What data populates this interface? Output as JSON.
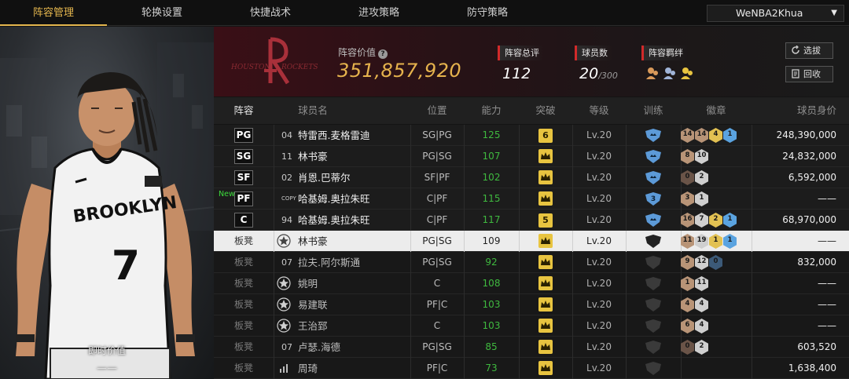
{
  "nav": {
    "tabs": [
      "阵容管理",
      "轮换设置",
      "快捷战术",
      "进攻策略",
      "防守策略"
    ],
    "active_tab": 0,
    "user": "WeNBA2Khua"
  },
  "player_card": {
    "jersey_text": "BROOKLYN",
    "jersey_number": "7",
    "instant_value_label": "即时价值",
    "instant_value": "——"
  },
  "team": {
    "logo_text_1": "HOUSTON",
    "logo_text_2": "ROCKETS",
    "value_label": "阵容价值",
    "value": "351,857,920",
    "overall_label": "阵容总评",
    "overall": "112",
    "players_label": "球员数",
    "players": "20",
    "players_max": "/300",
    "bond_label": "阵容羁绊",
    "btn_select": "选拔",
    "btn_recycle": "回收"
  },
  "table": {
    "headers": [
      "阵容",
      "球员名",
      "位置",
      "能力",
      "突破",
      "等级",
      "训练",
      "徽章",
      "球员身价"
    ],
    "rows": [
      {
        "slot": "PG",
        "bench": false,
        "new": false,
        "jersey": "04",
        "name": "特雷西.麦格雷迪",
        "pos": "SG|PG",
        "ability": "125",
        "breakthrough": "6",
        "level": "Lv.20",
        "training": "",
        "badges": [
          "14",
          "14",
          "4",
          "1"
        ],
        "badge_colors": [
          "#b89477",
          "#b89477",
          "#e2c152",
          "#5aa3e0"
        ],
        "salary": "248,390,000"
      },
      {
        "slot": "SG",
        "bench": false,
        "new": false,
        "jersey": "11",
        "name": "林书豪",
        "pos": "PG|SG",
        "ability": "107",
        "breakthrough": "",
        "level": "Lv.20",
        "training": "",
        "badges": [
          "8",
          "10"
        ],
        "badge_colors": [
          "#b89477",
          "#cfcfcf"
        ],
        "salary": "24,832,000"
      },
      {
        "slot": "SF",
        "bench": false,
        "new": false,
        "jersey": "02",
        "name": "肖恩.巴蒂尔",
        "pos": "SF|PF",
        "ability": "102",
        "breakthrough": "",
        "level": "Lv.20",
        "training": "",
        "badges": [
          "0",
          "2"
        ],
        "badge_colors": [
          "#6a5448",
          "#cfcfcf"
        ],
        "salary": "6,592,000"
      },
      {
        "slot": "PF",
        "bench": false,
        "new": true,
        "new_label": "New",
        "jersey": "COPY",
        "name": "哈基姆.奥拉朱旺",
        "pos": "C|PF",
        "ability": "115",
        "breakthrough": "",
        "level": "Lv.20",
        "training": "3",
        "badges": [
          "3",
          "1"
        ],
        "badge_colors": [
          "#b89477",
          "#cfcfcf"
        ],
        "salary": "——"
      },
      {
        "slot": "C",
        "bench": false,
        "new": false,
        "jersey": "94",
        "name": "哈基姆.奥拉朱旺",
        "pos": "C|PF",
        "ability": "117",
        "breakthrough": "5",
        "level": "Lv.20",
        "training": "",
        "badges": [
          "16",
          "7",
          "2",
          "1"
        ],
        "badge_colors": [
          "#b89477",
          "#cfcfcf",
          "#e2c152",
          "#5aa3e0"
        ],
        "salary": "68,970,000"
      },
      {
        "slot": "板凳",
        "bench": true,
        "highlight": true,
        "new": false,
        "jersey": "",
        "name": "林书豪",
        "pos": "PG|SG",
        "ability": "109",
        "breakthrough": "",
        "level": "Lv.20",
        "training": "",
        "badges": [
          "11",
          "19",
          "1",
          "1"
        ],
        "badge_colors": [
          "#b89477",
          "#cfcfcf",
          "#e2c152",
          "#5aa3e0"
        ],
        "salary": "——"
      },
      {
        "slot": "板凳",
        "bench": true,
        "new": false,
        "jersey": "07",
        "name": "拉夫.阿尔斯通",
        "pos": "PG|SG",
        "ability": "92",
        "breakthrough": "",
        "level": "Lv.20",
        "training": "",
        "badges": [
          "9",
          "12",
          "0"
        ],
        "badge_colors": [
          "#b89477",
          "#cfcfcf",
          "#3c5a78"
        ],
        "salary": "832,000"
      },
      {
        "slot": "板凳",
        "bench": true,
        "new": false,
        "jersey": "",
        "name": "姚明",
        "pos": "C",
        "ability": "108",
        "breakthrough": "",
        "level": "Lv.20",
        "training": "",
        "badges": [
          "1",
          "11"
        ],
        "badge_colors": [
          "#b89477",
          "#cfcfcf"
        ],
        "salary": "——"
      },
      {
        "slot": "板凳",
        "bench": true,
        "new": false,
        "jersey": "",
        "name": "易建联",
        "pos": "PF|C",
        "ability": "103",
        "breakthrough": "",
        "level": "Lv.20",
        "training": "",
        "badges": [
          "4",
          "4"
        ],
        "badge_colors": [
          "#b89477",
          "#cfcfcf"
        ],
        "salary": "——"
      },
      {
        "slot": "板凳",
        "bench": true,
        "new": false,
        "jersey": "",
        "name": "王治郅",
        "pos": "C",
        "ability": "103",
        "breakthrough": "",
        "level": "Lv.20",
        "training": "",
        "badges": [
          "6",
          "4"
        ],
        "badge_colors": [
          "#b89477",
          "#cfcfcf"
        ],
        "salary": "——"
      },
      {
        "slot": "板凳",
        "bench": true,
        "new": false,
        "jersey": "07",
        "name": "卢瑟.海德",
        "pos": "PG|SG",
        "ability": "85",
        "breakthrough": "",
        "level": "Lv.20",
        "training": "",
        "badges": [
          "0",
          "2"
        ],
        "badge_colors": [
          "#6a5448",
          "#cfcfcf"
        ],
        "salary": "603,520"
      },
      {
        "slot": "板凳",
        "bench": true,
        "new": false,
        "jersey": "",
        "name": "周琦",
        "pos": "PF|C",
        "ability": "73",
        "breakthrough": "",
        "level": "Lv.20",
        "training": "",
        "badges": [],
        "badge_colors": [],
        "salary": "1,638,400"
      }
    ]
  },
  "colors": {
    "accent": "#e4b64e",
    "ability_green": "#3fb93f",
    "red_marker": "#d22a2a"
  }
}
